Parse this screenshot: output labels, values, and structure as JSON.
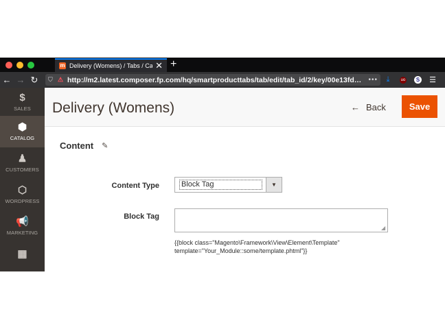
{
  "browser": {
    "tab_title": "Delivery (Womens) / Tabs / Cat…",
    "tab_close": "✕",
    "new_tab": "+",
    "url": "http://m2.latest.composer.fp.com/hq/smartproducttabs/tab/edit/tab_id/2/key/00e13fd…",
    "url_more": "•••"
  },
  "sidebar": {
    "items": [
      {
        "icon": "$",
        "label": "SALES"
      },
      {
        "icon": "⬢",
        "label": "CATALOG"
      },
      {
        "icon": "♟",
        "label": "CUSTOMERS"
      },
      {
        "icon": "⬡",
        "label": "WORDPRESS"
      },
      {
        "icon": "📢",
        "label": "MARKETING"
      },
      {
        "icon": "▦",
        "label": ""
      }
    ],
    "active": "CATALOG"
  },
  "header": {
    "title": "Delivery (Womens)",
    "back_label": "Back",
    "save_label": "Save"
  },
  "section": {
    "title": "Content"
  },
  "form": {
    "content_type_label": "Content Type",
    "content_type_value": "Block Tag",
    "block_tag_label": "Block Tag",
    "block_tag_value": "",
    "block_tag_note": "{{block class=\"Magento\\Framework\\View\\Element\\Template\" template=\"Your_Module::some/template.phtml\"}}"
  },
  "colors": {
    "accent": "#eb5202",
    "sidebar_bg": "#373330",
    "sidebar_active": "#514943"
  }
}
